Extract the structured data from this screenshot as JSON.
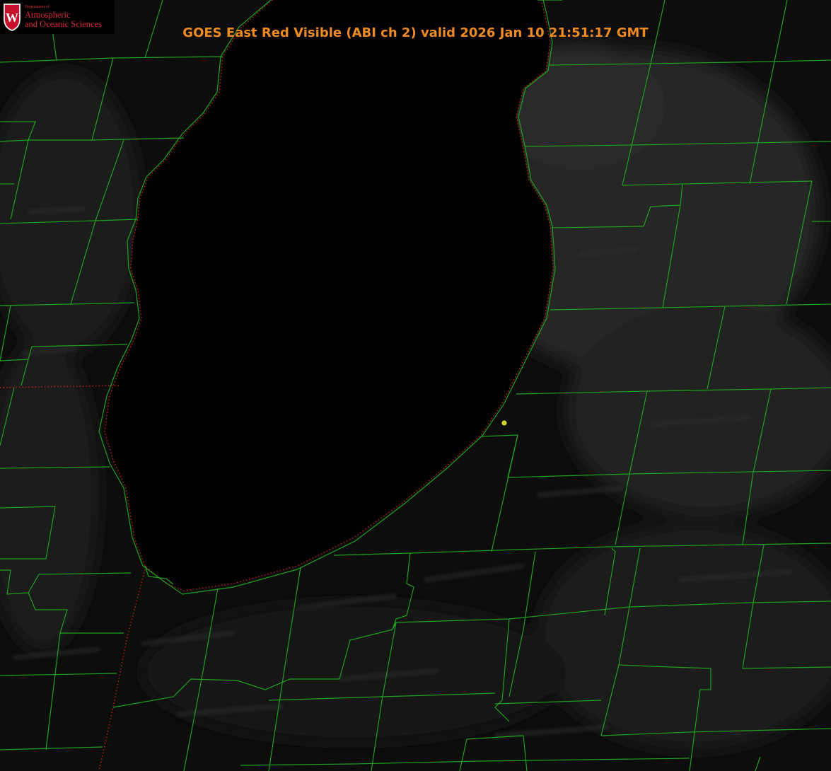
{
  "title": "GOES East Red Visible (ABI ch 2) valid 2026 Jan 10 21:51:17 GMT",
  "logo": {
    "department": "Department of",
    "line1": "Atmospheric",
    "line2": "and Oceanic Sciences",
    "crest_letter": "W"
  },
  "colors": {
    "title": "#ee8a22",
    "county_lines": "#1fa01f",
    "shoreline": "#d02020",
    "marker": "#d6d62a",
    "background": "#0a0a0a",
    "logo_text": "#d8283a"
  }
}
